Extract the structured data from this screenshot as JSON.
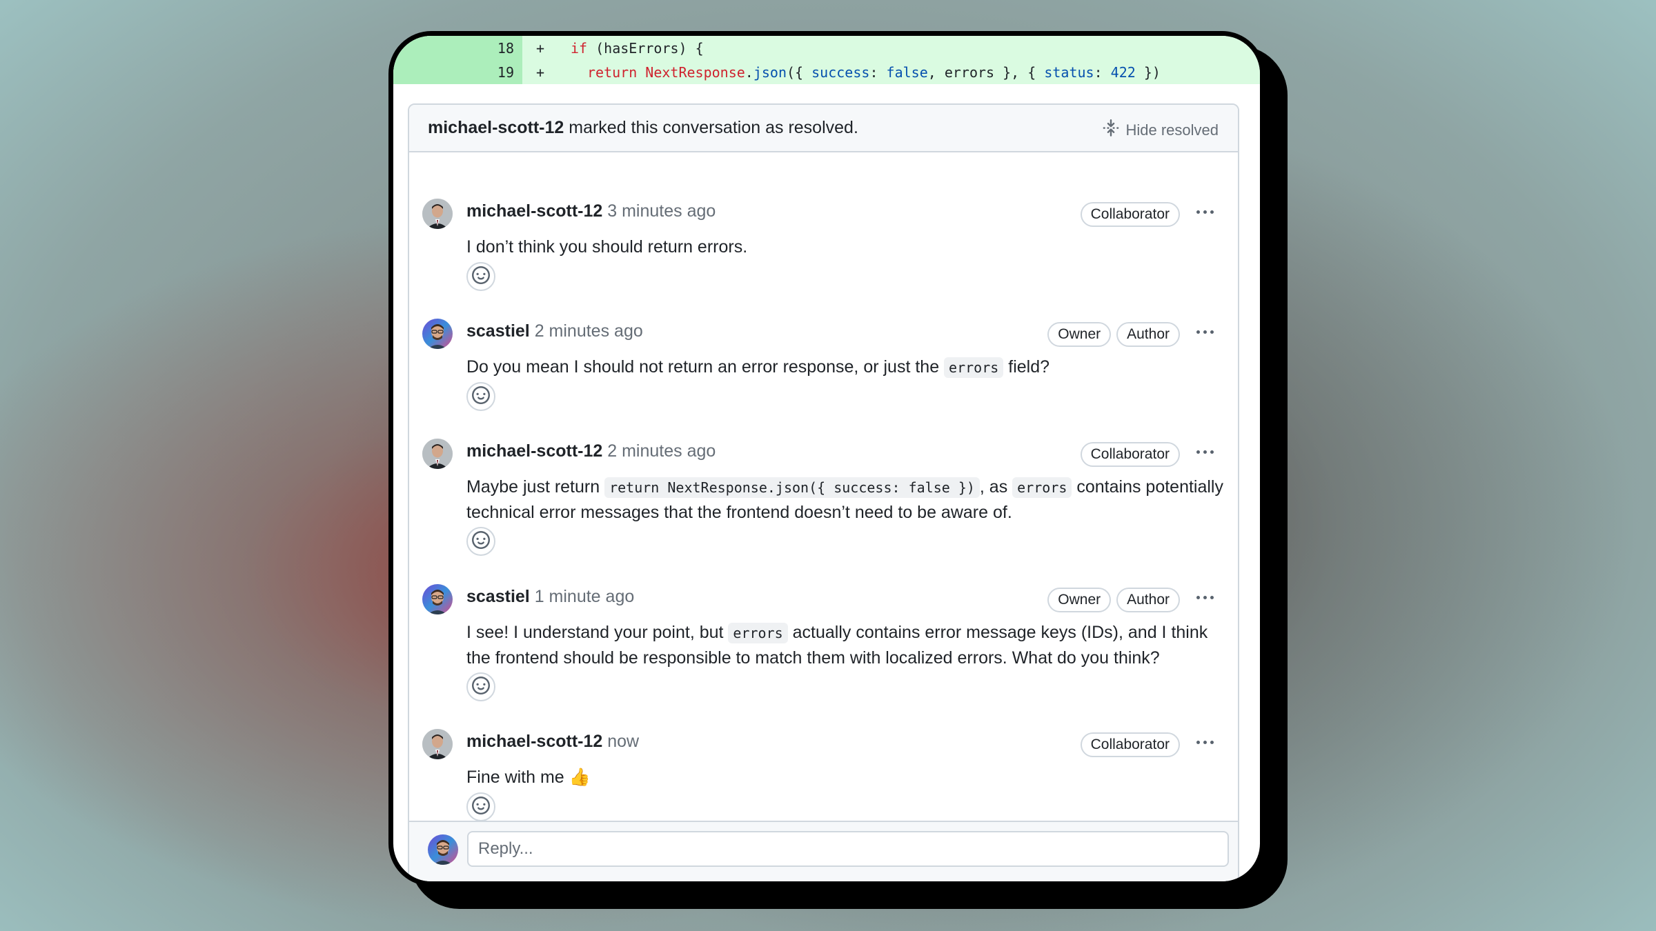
{
  "diff": {
    "lines": [
      {
        "num": "18",
        "sign": "+",
        "tokens": [
          {
            "t": "if",
            "c": "kw"
          },
          {
            "t": " (hasErrors) {",
            "c": ""
          }
        ]
      },
      {
        "num": "19",
        "sign": "+",
        "tokens": [
          {
            "t": "return",
            "c": "kw"
          },
          {
            "t": " ",
            "c": ""
          },
          {
            "t": "NextResponse",
            "c": "kw"
          },
          {
            "t": ".",
            "c": ""
          },
          {
            "t": "json",
            "c": "fn"
          },
          {
            "t": "({ ",
            "c": ""
          },
          {
            "t": "success",
            "c": "fn"
          },
          {
            "t": ": ",
            "c": ""
          },
          {
            "t": "false",
            "c": "lit"
          },
          {
            "t": ", errors }, { ",
            "c": ""
          },
          {
            "t": "status",
            "c": "fn"
          },
          {
            "t": ": ",
            "c": ""
          },
          {
            "t": "422",
            "c": "lit"
          },
          {
            "t": " })",
            "c": ""
          }
        ]
      }
    ]
  },
  "resolved": {
    "user": "michael-scott-12",
    "text": " marked this conversation as resolved.",
    "hide_label": "Hide resolved"
  },
  "comments": [
    {
      "author": "michael-scott-12",
      "time": "3 minutes ago",
      "badges": [
        "Collaborator"
      ],
      "body": [
        {
          "t": "I don’t think you should return errors.",
          "code": false
        }
      ]
    },
    {
      "author": "scastiel",
      "time": "2 minutes ago",
      "badges": [
        "Owner",
        "Author"
      ],
      "body": [
        {
          "t": "Do you mean I should not return an error response, or just the ",
          "code": false
        },
        {
          "t": "errors",
          "code": true
        },
        {
          "t": " field?",
          "code": false
        }
      ]
    },
    {
      "author": "michael-scott-12",
      "time": "2 minutes ago",
      "badges": [
        "Collaborator"
      ],
      "body": [
        {
          "t": "Maybe just return ",
          "code": false
        },
        {
          "t": "return NextResponse.json({ success: false })",
          "code": true
        },
        {
          "t": ", as ",
          "code": false
        },
        {
          "t": "errors",
          "code": true
        },
        {
          "t": " contains potentially technical error messages that the frontend doesn’t need to be aware of.",
          "code": false
        }
      ]
    },
    {
      "author": "scastiel",
      "time": "1 minute ago",
      "badges": [
        "Owner",
        "Author"
      ],
      "body": [
        {
          "t": "I see! I understand your point, but ",
          "code": false
        },
        {
          "t": "errors",
          "code": true
        },
        {
          "t": " actually contains error message keys (IDs), and I think the frontend should be responsible to match them with localized errors. What do you think?",
          "code": false
        }
      ]
    },
    {
      "author": "michael-scott-12",
      "time": "now",
      "badges": [
        "Collaborator"
      ],
      "body": [
        {
          "t": "Fine with me 👍",
          "code": false
        }
      ]
    }
  ],
  "reply": {
    "placeholder": "Reply..."
  },
  "colors": {
    "diff_add_bg": "#dafbe1",
    "diff_gutter_bg": "#aceebb",
    "keyword": "#cf222e",
    "function": "#0550ae"
  }
}
